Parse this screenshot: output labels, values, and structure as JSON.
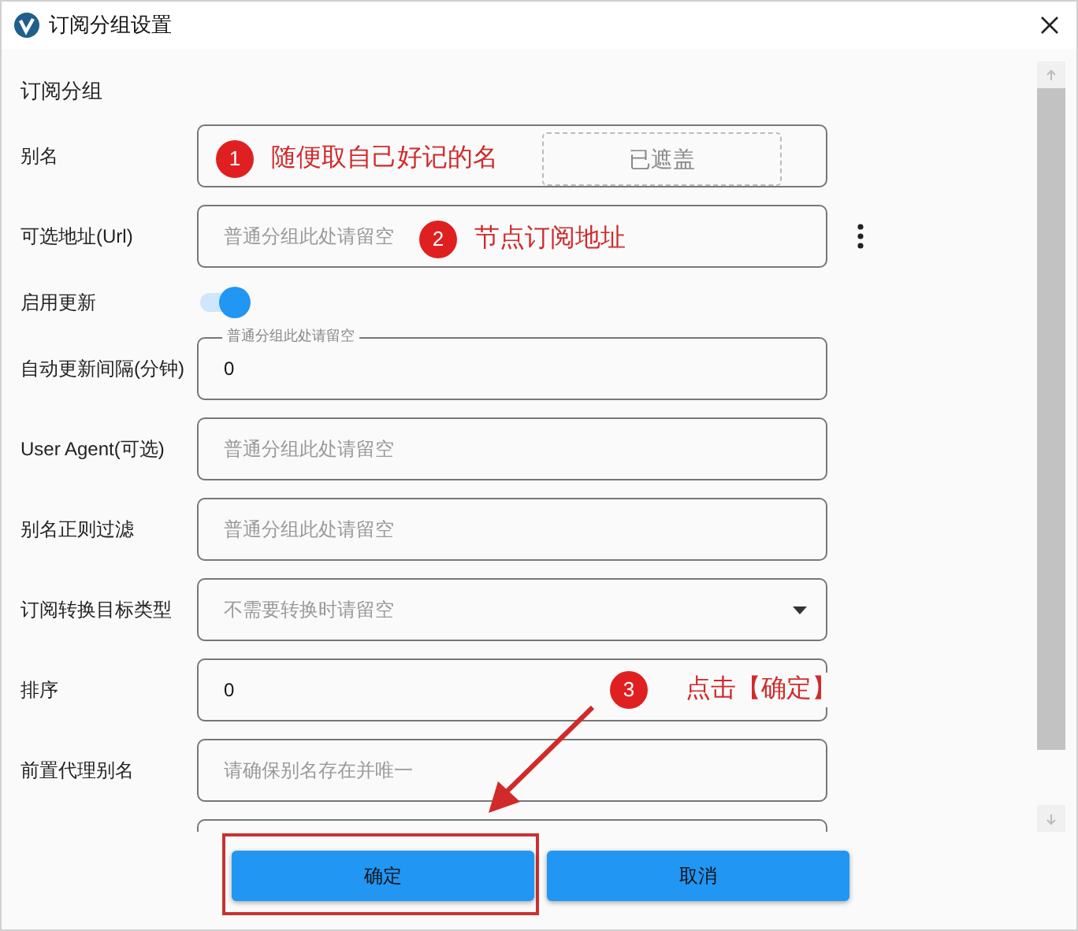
{
  "window": {
    "title": "订阅分组设置"
  },
  "section_title": "订阅分组",
  "fields": [
    {
      "kind": "text",
      "label": "别名"
    },
    {
      "kind": "text",
      "label": "可选地址(Url)",
      "placeholder": "普通分组此处请留空",
      "menu": true
    },
    {
      "kind": "toggle",
      "label": "启用更新",
      "on": true
    },
    {
      "kind": "text",
      "label": "自动更新间隔(分钟)",
      "floating_label": "普通分组此处请留空",
      "value": "0"
    },
    {
      "kind": "text",
      "label": "User Agent(可选)",
      "placeholder": "普通分组此处请留空"
    },
    {
      "kind": "text",
      "label": "别名正则过滤",
      "placeholder": "普通分组此处请留空"
    },
    {
      "kind": "select",
      "label": "订阅转换目标类型",
      "placeholder": "不需要转换时请留空"
    },
    {
      "kind": "text",
      "label": "排序",
      "value": "0"
    },
    {
      "kind": "text",
      "label": "前置代理别名",
      "placeholder": "请确保别名存在并唯一"
    },
    {
      "kind": "text"
    }
  ],
  "buttons": [
    {
      "label": "确定",
      "highlighted": true
    },
    {
      "label": "取消",
      "highlighted": false
    }
  ],
  "annotations": [
    {
      "number": "1",
      "text": "随便取自己好记的名"
    },
    {
      "number": "2",
      "text": "节点订阅地址"
    },
    {
      "number": "3",
      "text": "点击【确定】"
    }
  ],
  "mask": {
    "label": "已遮盖"
  }
}
